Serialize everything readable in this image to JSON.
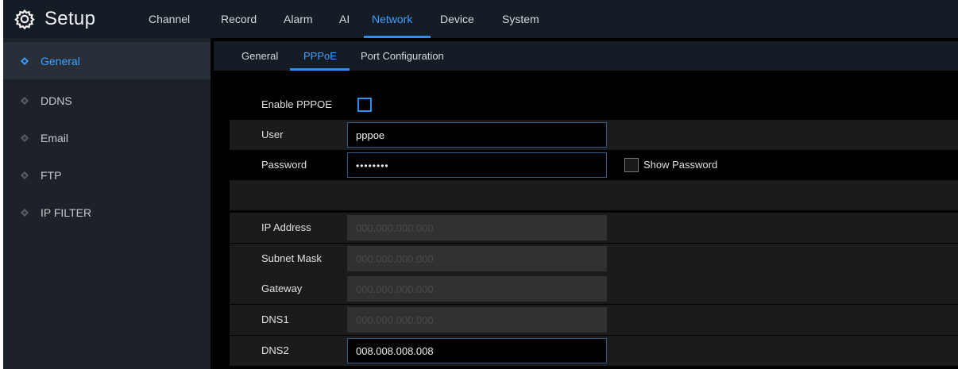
{
  "header": {
    "title": "Setup",
    "menu": [
      {
        "label": "Channel",
        "active": false
      },
      {
        "label": "Record",
        "active": false
      },
      {
        "label": "Alarm",
        "active": false
      },
      {
        "label": "AI",
        "active": false
      },
      {
        "label": "Network",
        "active": true
      },
      {
        "label": "Device",
        "active": false
      },
      {
        "label": "System",
        "active": false
      }
    ]
  },
  "sidebar": {
    "items": [
      {
        "label": "General",
        "active": true
      },
      {
        "label": "DDNS",
        "active": false
      },
      {
        "label": "Email",
        "active": false
      },
      {
        "label": "FTP",
        "active": false
      },
      {
        "label": "IP FILTER",
        "active": false
      }
    ]
  },
  "subtabs": [
    {
      "label": "General",
      "active": false
    },
    {
      "label": "PPPoE",
      "active": true
    },
    {
      "label": "Port Configuration",
      "active": false
    }
  ],
  "form": {
    "enable_label": "Enable PPPOE",
    "enable_checked": false,
    "user_label": "User",
    "user_value": "pppoe",
    "password_label": "Password",
    "password_value": "••••••••",
    "show_password_label": "Show Password",
    "show_password_checked": false,
    "ip_label": "IP Address",
    "ip_value": "000.000.000.000",
    "subnet_label": "Subnet Mask",
    "subnet_value": "000.000.000.000",
    "gateway_label": "Gateway",
    "gateway_value": "000.000.000.000",
    "dns1_label": "DNS1",
    "dns1_value": "000.000.000.000",
    "dns2_label": "DNS2",
    "dns2_value": "008.008.008.008"
  },
  "colors": {
    "accent": "#2d8ff2",
    "topbar": "#141c26",
    "sidebar": "#1d222a",
    "background": "#000000"
  },
  "icons": {
    "brand": "gear-icon",
    "sidebar_bullet": "diamond-bullet-icon"
  }
}
